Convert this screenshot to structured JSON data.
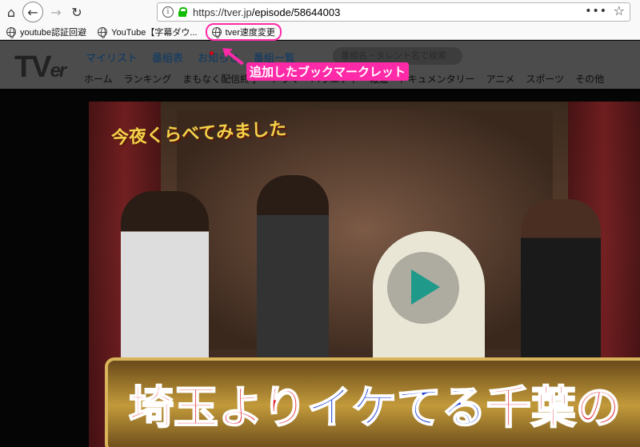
{
  "browser": {
    "url_host": "https://tver.jp",
    "url_path": "/episode/58644003",
    "menu_dots": "•••",
    "star": "☆",
    "bookmarks": [
      {
        "label": "youtube認証回避"
      },
      {
        "label": "YouTube【字幕ダウ..."
      },
      {
        "label": "tver速度変更"
      }
    ]
  },
  "site": {
    "logo_t": "TV",
    "logo_er": "er",
    "topnav": [
      "マイリスト",
      "番組表",
      "お知らせ",
      "番組一覧"
    ],
    "search_placeholder": "番組名・タレント名で検索",
    "categories": [
      "ホーム",
      "ランキング",
      "まもなく配信終了",
      "ドラマ",
      "バラエティ",
      "報道・ドキュメンタリー",
      "アニメ",
      "スポーツ",
      "その他"
    ]
  },
  "annotation": {
    "text": "追加したブックマークレット",
    "color": "#ff2aa8"
  },
  "video": {
    "banner": "今夜くらべてみました",
    "caption_red": "埼玉より",
    "caption_blue": "イケてる",
    "caption_red2": "千葉の"
  }
}
